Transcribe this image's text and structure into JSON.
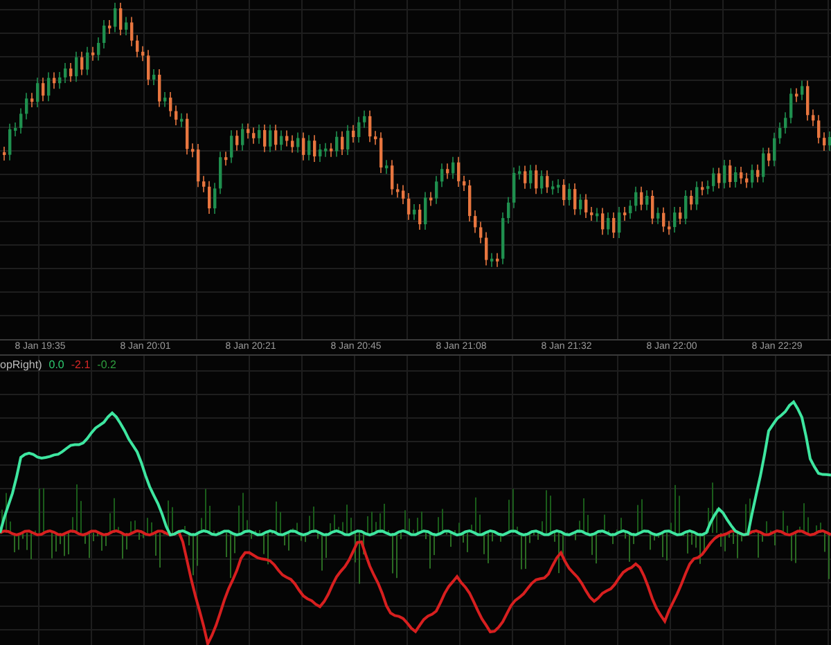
{
  "time_axis": {
    "labels": [
      "8 Jan 19:35",
      "8 Jan 20:01",
      "8 Jan 20:21",
      "8 Jan 20:45",
      "8 Jan 21:08",
      "8 Jan 21:32",
      "8 Jan 22:00",
      "8 Jan 22:29"
    ]
  },
  "indicator": {
    "name": "opRight)",
    "values": [
      {
        "text": "0.0",
        "color": "#2ecc71"
      },
      {
        "text": "-2.1",
        "color": "#d62828"
      },
      {
        "text": "-0.2",
        "color": "#2e9e3e"
      }
    ]
  }
}
